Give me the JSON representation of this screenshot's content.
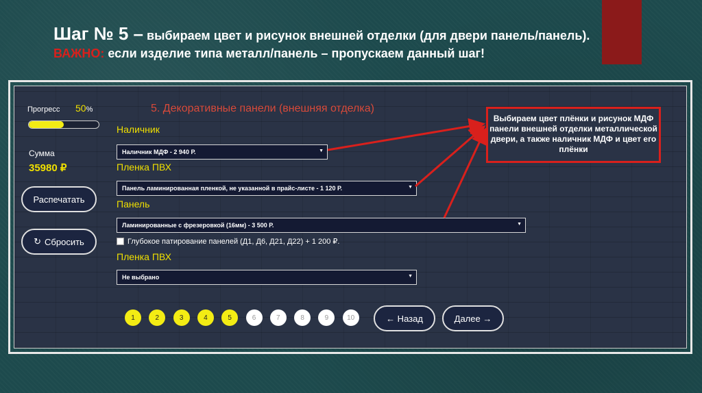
{
  "slide": {
    "title_step": "Шаг № 5 –",
    "title_text": " выбираем цвет и рисунок внешней отделки (для двери панель/панель).",
    "warning_label": "ВАЖНО:",
    "warning_text": " если изделие типа металл/панель – пропускаем данный шаг!"
  },
  "sidebar": {
    "progress_label": "Прогресс",
    "progress_value": "50",
    "progress_sign": "%",
    "progress_fraction": 0.5,
    "sum_label": "Сумма",
    "sum_value": "35980 ₽",
    "print_button": "Распечатать",
    "reset_icon": "↻",
    "reset_button": "Сбросить"
  },
  "form": {
    "section_title": "5. Декоративные панели (внешняя отделка)",
    "fields": [
      {
        "label": "Наличник",
        "value": "Наличник МДФ - 2 940 Р."
      },
      {
        "label": "Пленка ПВХ",
        "value": "Панель ламинированная пленкой, не указанной в прайс-листе - 1 120 Р."
      },
      {
        "label": "Панель",
        "value": "Ламинированные с фрезеровкой (16мм) - 3 500 Р."
      },
      {
        "label": "Пленка ПВХ",
        "value": "Не выбрано"
      }
    ],
    "checkbox_label": "Глубокое патирование панелей (Д1, Д6, Д21, Д22) + 1 200 ₽.",
    "checkbox_checked": false
  },
  "steps": [
    "1",
    "2",
    "3",
    "4",
    "5",
    "6",
    "7",
    "8",
    "9",
    "10"
  ],
  "current_step": 5,
  "nav": {
    "back": "← Назад",
    "next": "Далее →"
  },
  "callout": {
    "text": "Выбираем цвет плёнки и рисунок МДФ панели внешней отделки металлической двери, а также наличник МДФ и цвет его плёнки"
  },
  "colors": {
    "accent_yellow": "#f3ec14",
    "warning_red": "#d9201c",
    "section_red": "#d84a3a",
    "panel_bg": "#2a3346"
  }
}
